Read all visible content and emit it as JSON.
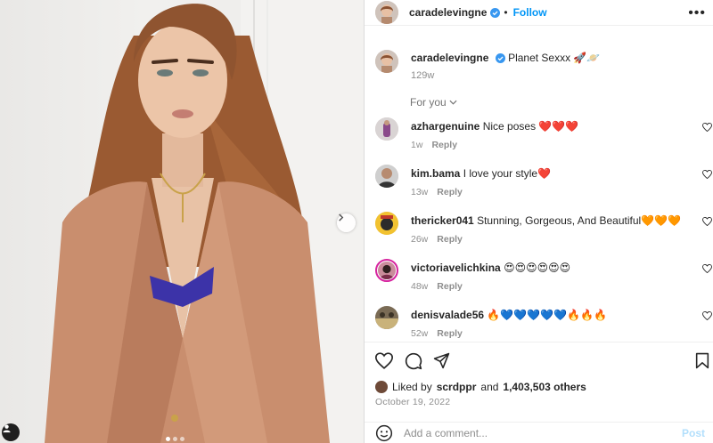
{
  "post": {
    "author": "caradelevingne",
    "follow_label": "Follow",
    "more_label": "•••",
    "caption_text": "Planet Sexxx 🚀🪐",
    "caption_age": "129w",
    "for_you_label": "For you",
    "likes_prefix": "Liked by",
    "liked_by_user": "scrdppr",
    "likes_joiner": "and",
    "likes_count": "1,403,503 others",
    "date": "October 19, 2022",
    "add_comment_placeholder": "Add a comment...",
    "post_button": "Post"
  },
  "comments": [
    {
      "user": "azhargenuine",
      "text": "Nice poses ❤️❤️❤️",
      "age": "1w",
      "reply": "Reply"
    },
    {
      "user": "kim.bama",
      "text": "I love your style❤️",
      "age": "13w",
      "reply": "Reply"
    },
    {
      "user": "thericker041",
      "text": "Stunning, Gorgeous, And Beautiful🧡🧡🧡",
      "age": "26w",
      "reply": "Reply"
    },
    {
      "user": "victoriavelichkina",
      "text": "😍😍😍😍😍😍",
      "age": "48w",
      "reply": "Reply"
    },
    {
      "user": "denisvalade56",
      "text": "🔥💙💙💙💙💙🔥🔥🔥",
      "age": "52w",
      "reply": "Reply"
    }
  ],
  "colors": {
    "accent": "#0095f6",
    "verified": "#3897f0",
    "muted": "#8e8e8e",
    "jacket": "#c98e6e",
    "hair": "#9a5a32"
  },
  "icons": [
    "verified-badge-icon",
    "chevron-right-icon",
    "chevron-down-icon",
    "heart-icon",
    "comment-icon",
    "share-icon",
    "bookmark-icon",
    "emoji-icon",
    "user-tag-icon"
  ]
}
